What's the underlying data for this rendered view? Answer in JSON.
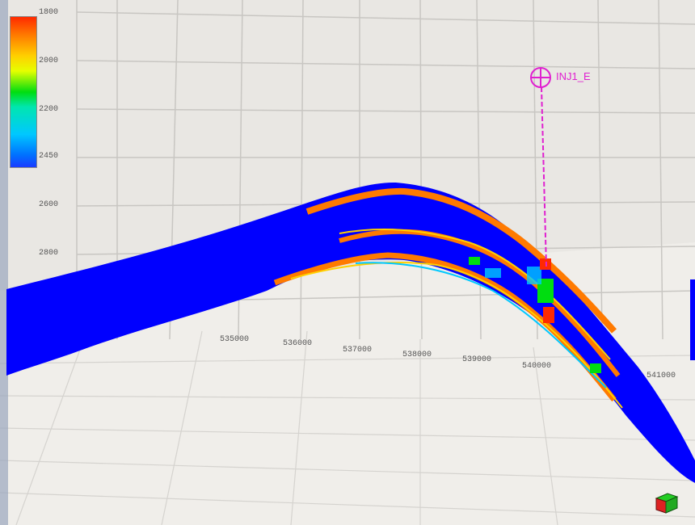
{
  "colorbar": {
    "ticks": [
      "1800",
      "2000",
      "2200",
      "2450"
    ],
    "gradient_top": "#ff2a00",
    "gradient_bottom": "#1a3cff"
  },
  "axis_z": {
    "ticks": [
      "1800",
      "2000",
      "2200",
      "2450",
      "2600",
      "2800"
    ]
  },
  "axis_x": {
    "ticks": [
      "535000",
      "536000",
      "537000",
      "538000",
      "539000",
      "540000",
      "541000"
    ]
  },
  "well": {
    "label": "INJ1_E",
    "color": "#e020d0"
  },
  "model": {
    "base_color": "#0000ff",
    "layer_colors": [
      "#ff7a00",
      "#ffd000",
      "#00dd10",
      "#00c8ff",
      "#ff2a00"
    ]
  },
  "icons": {
    "nav_cube": "orientation-cube-icon",
    "well_head": "well-target-icon"
  }
}
